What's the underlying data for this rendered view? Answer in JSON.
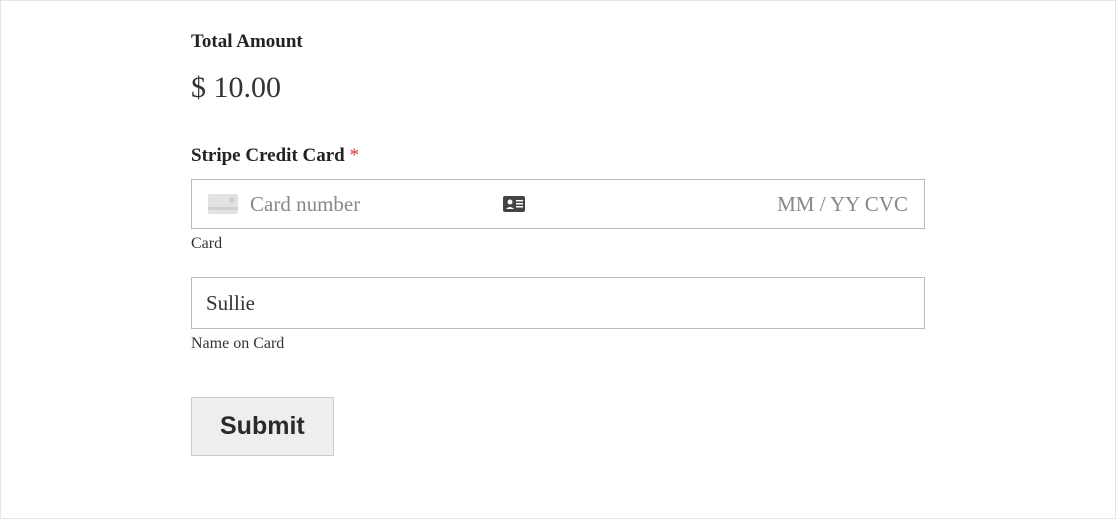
{
  "total": {
    "label": "Total Amount",
    "value": "$ 10.00"
  },
  "stripe": {
    "label": "Stripe Credit Card",
    "required_mark": "*",
    "card_number_placeholder": "Card number",
    "expiry_cvc_placeholder": "MM / YY  CVC",
    "card_sublabel": "Card",
    "name_value": "Sullie",
    "name_sublabel": "Name on Card"
  },
  "submit_label": "Submit"
}
